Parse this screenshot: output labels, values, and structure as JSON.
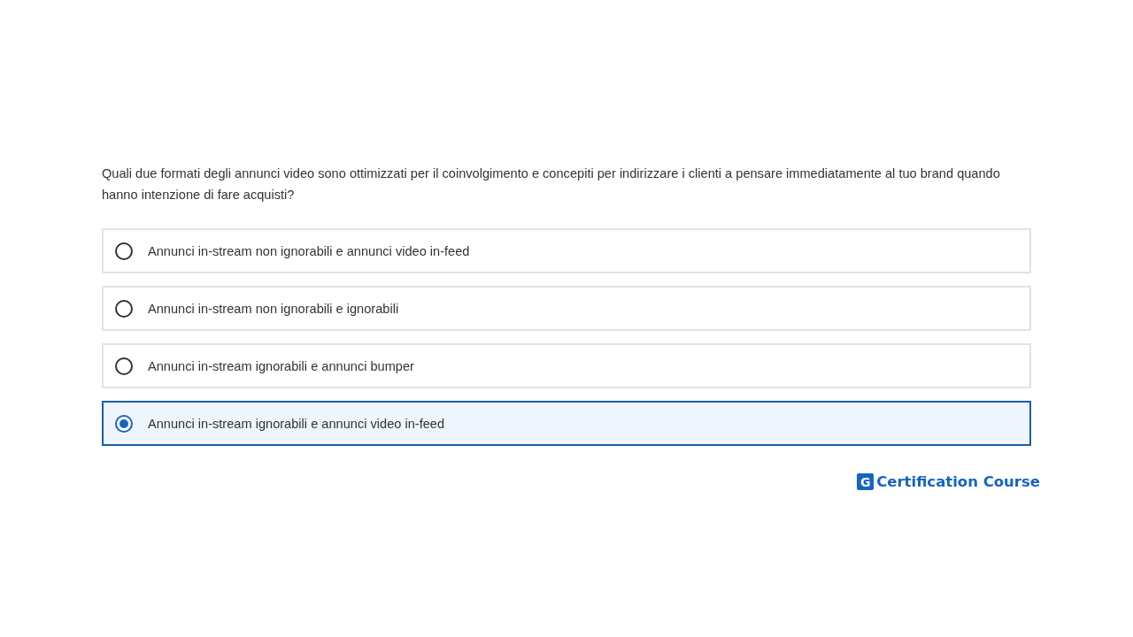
{
  "question": "Quali due formati degli annunci video sono ottimizzati per il coinvolgimento e concepiti per indirizzare i clienti a pensare immediatamente al tuo brand quando hanno intenzione di fare acquisti?",
  "options": [
    {
      "label": "Annunci in-stream non ignorabili e annunci video in-feed",
      "selected": false
    },
    {
      "label": "Annunci in-stream non ignorabili e ignorabili",
      "selected": false
    },
    {
      "label": "Annunci in-stream ignorabili e annunci bumper",
      "selected": false
    },
    {
      "label": "Annunci in-stream ignorabili e annunci video in-feed",
      "selected": true
    }
  ],
  "logo": {
    "mark": "G",
    "text": "Certification Course"
  }
}
